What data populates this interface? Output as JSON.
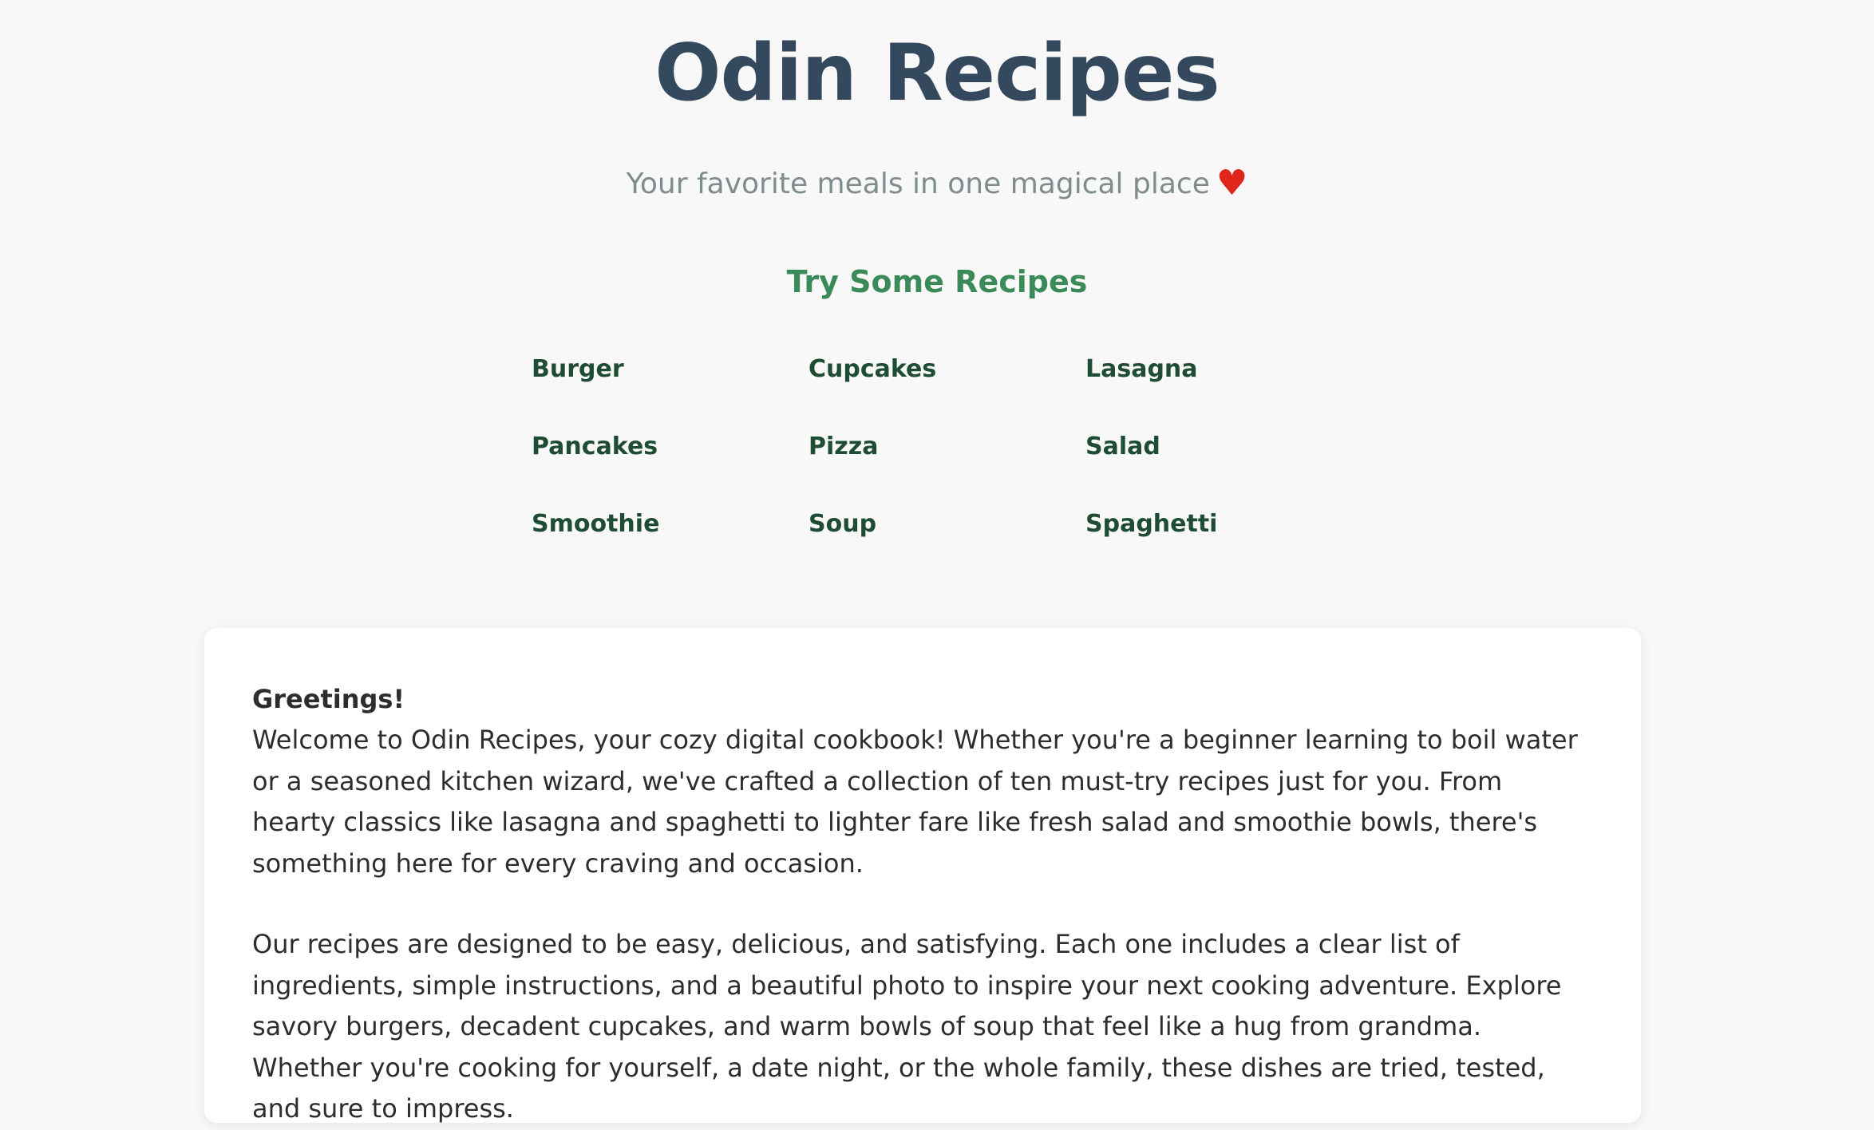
{
  "header": {
    "title": "Odin Recipes",
    "tagline": "Your favorite meals in one magical place",
    "tagline_icon": "heart-icon",
    "heart_glyph": "♥"
  },
  "recipes": {
    "heading": "Try Some Recipes",
    "items": [
      {
        "label": "Burger"
      },
      {
        "label": "Cupcakes"
      },
      {
        "label": "Lasagna"
      },
      {
        "label": "Pancakes"
      },
      {
        "label": "Pizza"
      },
      {
        "label": "Salad"
      },
      {
        "label": "Smoothie"
      },
      {
        "label": "Soup"
      },
      {
        "label": "Spaghetti"
      }
    ]
  },
  "intro": {
    "greeting": "Greetings!",
    "paragraphs": [
      "Welcome to Odin Recipes, your cozy digital cookbook! Whether you're a beginner learning to boil water or a seasoned kitchen wizard, we've crafted a collection of ten must-try recipes just for you. From hearty classics like lasagna and spaghetti to lighter fare like fresh salad and smoothie bowls, there's something here for every craving and occasion.",
      "Our recipes are designed to be easy, delicious, and satisfying. Each one includes a clear list of ingredients, simple instructions, and a beautiful photo to inspire your next cooking adventure. Explore savory burgers, decadent cupcakes, and warm bowls of soup that feel like a hug from grandma. Whether you're cooking for yourself, a date night, or the whole family, these dishes are tried, tested, and sure to impress."
    ]
  },
  "colors": {
    "background": "#f8f8f8",
    "title": "#34495e",
    "tagline": "#7f8c8d",
    "heading": "#3a8a5a",
    "link": "#1f4d33",
    "heart": "#e0261c",
    "card": "#ffffff"
  }
}
